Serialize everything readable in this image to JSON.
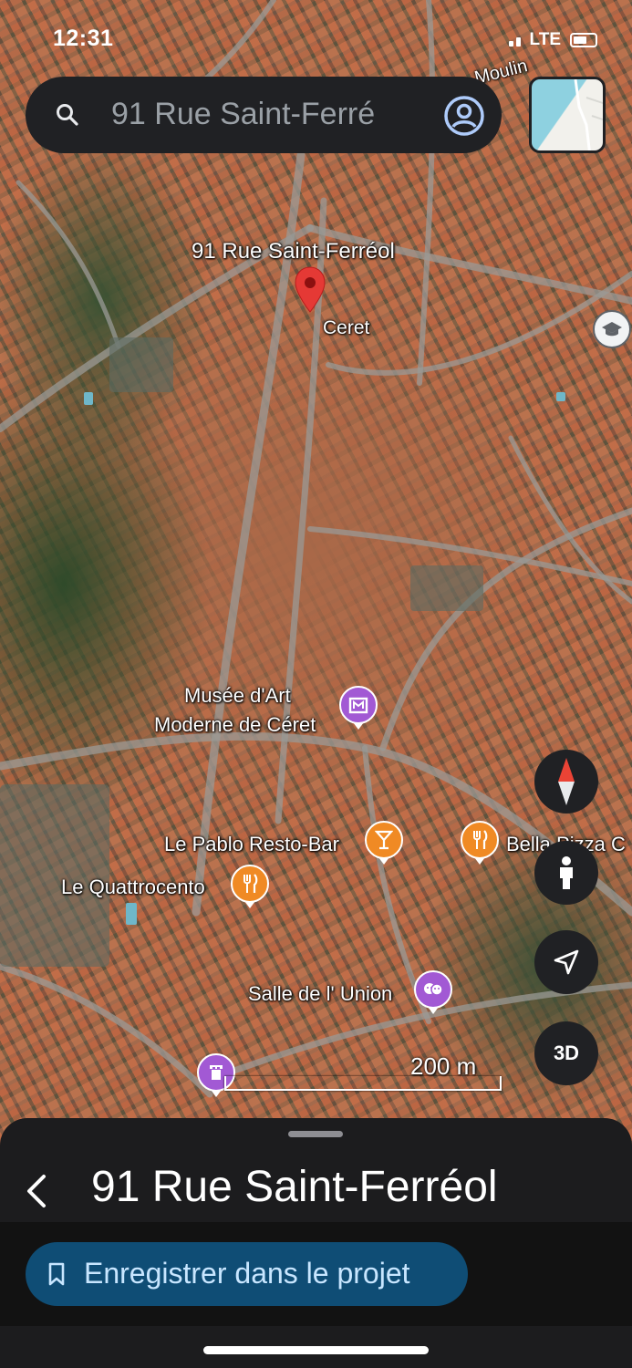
{
  "status_bar": {
    "time": "12:31",
    "network": "LTE"
  },
  "search": {
    "query": "91 Rue Saint-Ferré"
  },
  "map": {
    "labels": {
      "road_partial": "Moulin",
      "pinned_address": "91 Rue Saint-Ferréol",
      "town": "Ceret",
      "museum_line1": "Musée d'Art",
      "museum_line2": "Moderne de Céret",
      "bar": "Le Pablo Resto-Bar",
      "pizza": "Bella Pizza C",
      "restaurant": "Le Quattrocento",
      "venue": "Salle de l' Union"
    },
    "scale": "200 m"
  },
  "controls": {
    "three_d": "3D"
  },
  "sheet": {
    "title": "91 Rue Saint-Ferréol",
    "save_button": "Enregistrer dans le projet"
  },
  "colors": {
    "search_bg": "#202124",
    "save_button_bg": "#0f4d75",
    "poi_purple": "#a259d4",
    "poi_orange": "#f08a24",
    "pin_red": "#e53935"
  }
}
